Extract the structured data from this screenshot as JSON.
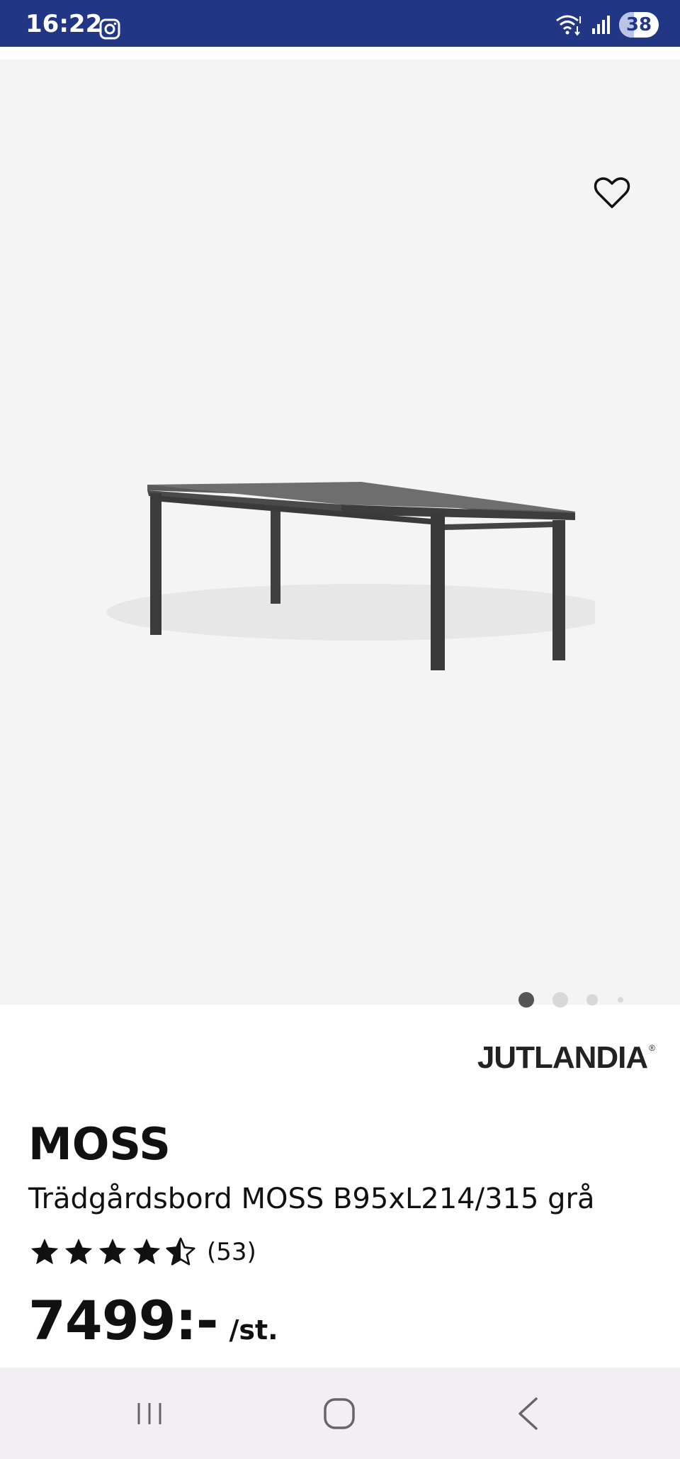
{
  "status_bar": {
    "time": "16:22",
    "battery_level": "38",
    "battery_fraction": 0.38,
    "icons": [
      "instagram-icon",
      "wifi-icon",
      "signal-icon",
      "battery-icon"
    ]
  },
  "gallery": {
    "favorite_icon": "heart-outline-icon",
    "image_count": 4,
    "active_index": 0
  },
  "product": {
    "brand": "JUTLANDIA",
    "brand_mark": "®",
    "name": "MOSS",
    "description": "Trädgårdsbord MOSS B95xL214/315 grå",
    "rating": 4.5,
    "rating_count": "(53)",
    "price": "7499:-",
    "unit": "/st."
  },
  "nav_bar": {
    "icons": [
      "recent-apps-icon",
      "home-icon",
      "back-icon"
    ]
  },
  "colors": {
    "status_bar": "#213685",
    "gallery_bg": "#f4f4f4",
    "nav_bg": "#f1eff1"
  }
}
